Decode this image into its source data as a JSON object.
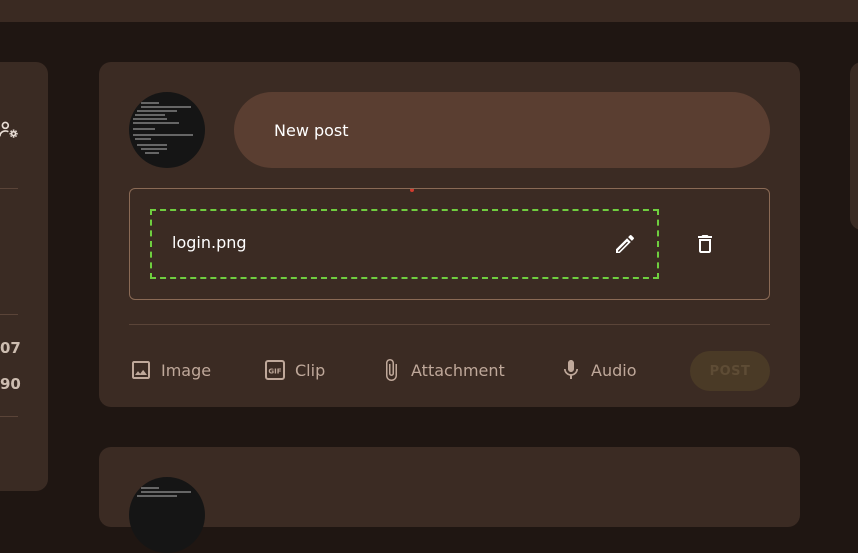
{
  "composer": {
    "placeholder": "New post",
    "attachment": {
      "file_name": "login.png",
      "edit_icon": "pencil-icon",
      "delete_icon": "trash-icon"
    },
    "tools": [
      {
        "label": "Image",
        "icon": "image-icon"
      },
      {
        "label": "Clip",
        "icon": "gif-icon"
      },
      {
        "label": "Attachment",
        "icon": "paperclip-icon"
      },
      {
        "label": "Audio",
        "icon": "microphone-icon"
      }
    ],
    "post_label": "POST"
  },
  "sidebar": {
    "stats": [
      "07",
      "90"
    ],
    "icon": "group-settings-icon"
  },
  "colors": {
    "background": "#1f1612",
    "card": "#3b2b23",
    "input": "#5a3e31",
    "dashed_border": "#6fcf3f",
    "tool_text": "#bfa89a"
  }
}
